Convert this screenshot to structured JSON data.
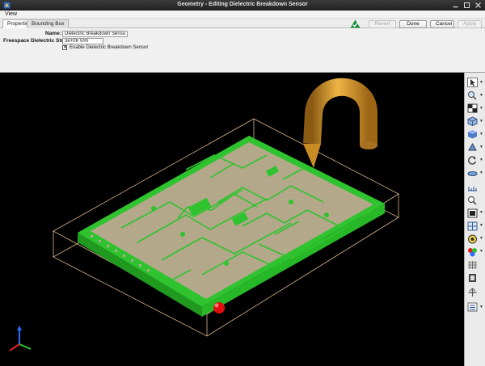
{
  "window": {
    "title": "Geometry - Editing Dielectric Breakdown Sensor"
  },
  "menu": {
    "view_label": "View"
  },
  "tabs": [
    {
      "label": "Properties",
      "active": true
    },
    {
      "label": "Bounding Box",
      "active": false
    }
  ],
  "actions": {
    "revert_label": "Revert",
    "done_label": "Done",
    "cancel_label": "Cancel",
    "apply_label": "Apply"
  },
  "properties": {
    "name_label": "Name:",
    "name_value": "Dielectric Breakdown Sensor",
    "strength_label": "Freespace Dielectric Strength:",
    "strength_value": "3e+06 V/m",
    "enable_label": "Enable Dielectric Breakdown Sensor",
    "enable_checked": true
  },
  "viewport": {
    "background": "#000000",
    "board_color": "#33cc33",
    "substrate_color": "#b3a88a",
    "bounding_box_color": "#d9b38c",
    "probe_color": "#d4912a",
    "sensor_color": "#e01010",
    "axes_icon": "xyz-axes-icon"
  },
  "toolbar_icons": [
    "select-icon",
    "zoom-icon",
    "checker-icon",
    "view-cube-icon",
    "shaded-cube-icon",
    "wire-solid-icon",
    "rotate-icon",
    "plane-icon",
    "ruler-icon",
    "probe-point-icon",
    "camera-icon",
    "mesh-view-icon",
    "material-icon",
    "color-palette-icon",
    "grid-icon",
    "slice-icon",
    "pan-icon",
    "view-options-icon"
  ]
}
